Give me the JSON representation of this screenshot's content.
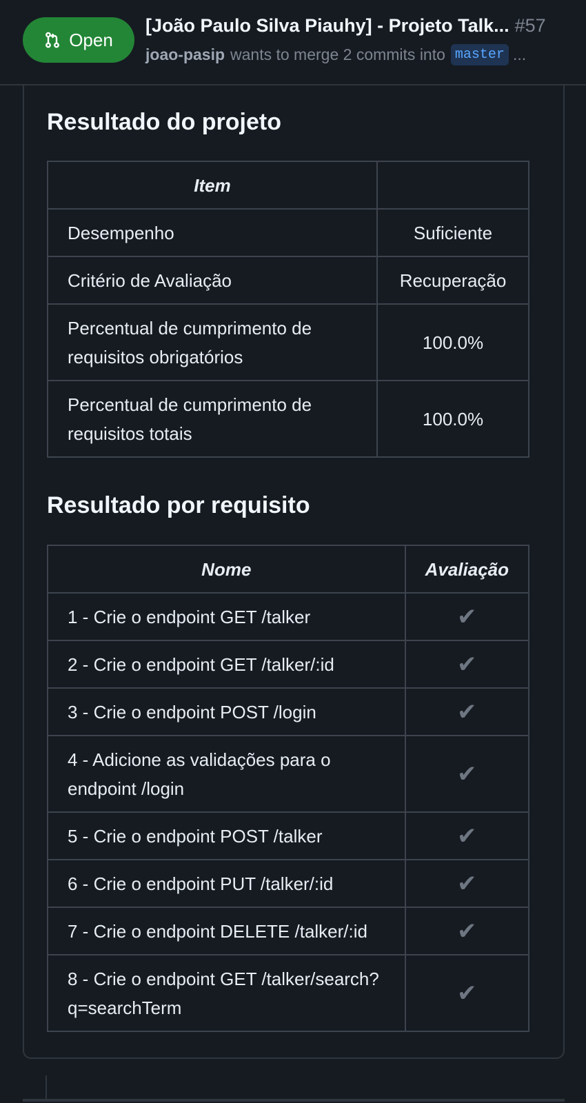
{
  "pr": {
    "state": "Open",
    "title": "[João Paulo Silva Piauhy] - Projeto Talk...",
    "number": "#57",
    "author": "joao-pasip",
    "merge_text": "wants to merge 2 commits into",
    "branch": "master",
    "overflow": "..."
  },
  "result": {
    "heading": "Resultado do projeto",
    "header": [
      "Item",
      ""
    ],
    "rows": [
      [
        "Desempenho",
        "Suficiente"
      ],
      [
        "Critério de Avaliação",
        "Recuperação"
      ],
      [
        "Percentual de cumprimento de requisitos obrigatórios",
        "100.0%"
      ],
      [
        "Percentual de cumprimento de requisitos totais",
        "100.0%"
      ]
    ]
  },
  "requirements": {
    "heading": "Resultado por requisito",
    "header": [
      "Nome",
      "Avaliação"
    ],
    "check_symbol": "✔",
    "rows": [
      "1 - Crie o endpoint GET /talker",
      "2 - Crie o endpoint GET /talker/:id",
      "3 - Crie o endpoint POST /login",
      "4 - Adicione as validações para o endpoint /login",
      "5 - Crie o endpoint POST /talker",
      "6 - Crie o endpoint PUT /talker/:id",
      "7 - Crie o endpoint DELETE /talker/:id",
      "8 - Crie o endpoint GET /talker/search?q=searchTerm"
    ]
  },
  "colors": {
    "background": "#161b22",
    "open_green": "#238636",
    "branch_blue": "#58a6ff",
    "muted": "#7d8590"
  }
}
